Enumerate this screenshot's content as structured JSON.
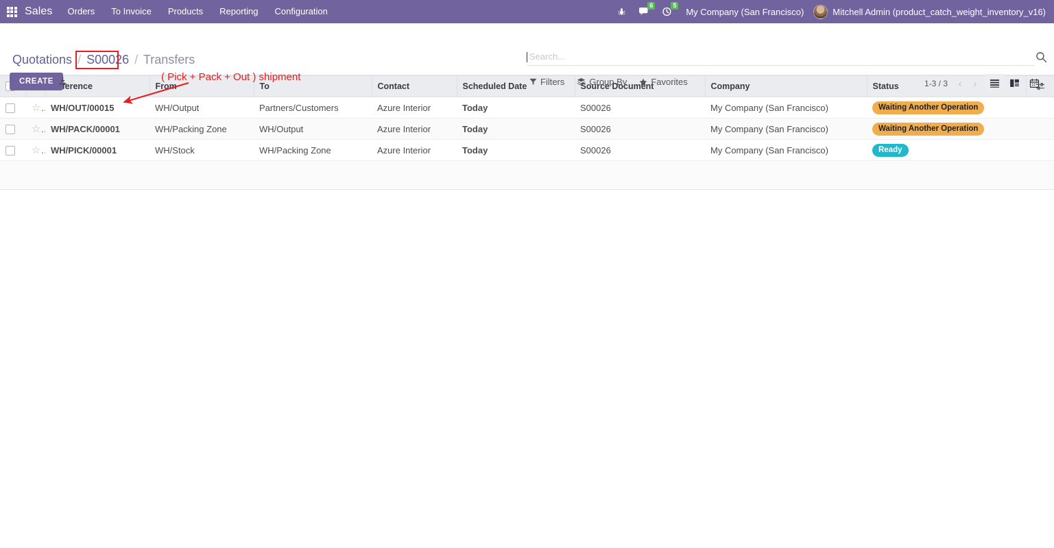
{
  "navbar": {
    "apps_icon": "apps-grid-icon",
    "brand": "Sales",
    "menu": [
      {
        "label": "Orders"
      },
      {
        "label": "To Invoice"
      },
      {
        "label": "Products"
      },
      {
        "label": "Reporting"
      },
      {
        "label": "Configuration"
      }
    ],
    "debug_icon": "bug-icon",
    "messages_icon": "chat-bubble-icon",
    "messages_count": "6",
    "activities_icon": "clock-icon",
    "activities_count": "5",
    "company": "My Company (San Francisco)",
    "user": "Mitchell Admin (product_catch_weight_inventory_v16)",
    "avatar": "user-avatar",
    "accent": "#71639e",
    "badge_color": "#5cb85c"
  },
  "breadcrumb": {
    "root": "Quotations",
    "sep": "/",
    "record": "S00026",
    "current": "Transfers"
  },
  "toolbar": {
    "create_label": "CREATE",
    "import_icon": "download-import-icon"
  },
  "annotation": {
    "text": "( Pick + Pack + Out ) shipment",
    "color": "#ec1c1c"
  },
  "search": {
    "placeholder": "Search...",
    "value": "",
    "search_icon": "search-icon",
    "filters_label": "Filters",
    "filters_icon": "filter-funnel-icon",
    "groupby_label": "Group By",
    "groupby_icon": "layers-icon",
    "favorites_label": "Favorites",
    "favorites_icon": "star-icon"
  },
  "pager": {
    "value": "1-3 / 3",
    "prev_icon": "chevron-left-icon",
    "next_icon": "chevron-right-icon"
  },
  "views": [
    {
      "name": "list",
      "icon": "list-view-icon",
      "active": true
    },
    {
      "name": "kanban",
      "icon": "kanban-view-icon",
      "active": false
    },
    {
      "name": "calendar",
      "icon": "calendar-view-icon",
      "active": false
    }
  ],
  "table": {
    "optional_columns_icon": "sliders-toggle-icon",
    "columns": [
      "Reference",
      "From",
      "To",
      "Contact",
      "Scheduled Date",
      "Source Document",
      "Company",
      "Status"
    ],
    "rows": [
      {
        "reference": "WH/OUT/00015",
        "from": "WH/Output",
        "to": "Partners/Customers",
        "contact": "Azure Interior",
        "scheduled_date": "Today",
        "source_document": "S00026",
        "company": "My Company (San Francisco)",
        "status": "Waiting Another Operation",
        "status_style": "warning"
      },
      {
        "reference": "WH/PACK/00001",
        "from": "WH/Packing Zone",
        "to": "WH/Output",
        "contact": "Azure Interior",
        "scheduled_date": "Today",
        "source_document": "S00026",
        "company": "My Company (San Francisco)",
        "status": "Waiting Another Operation",
        "status_style": "warning"
      },
      {
        "reference": "WH/PICK/00001",
        "from": "WH/Stock",
        "to": "WH/Packing Zone",
        "contact": "Azure Interior",
        "scheduled_date": "Today",
        "source_document": "S00026",
        "company": "My Company (San Francisco)",
        "status": "Ready",
        "status_style": "info"
      }
    ]
  }
}
